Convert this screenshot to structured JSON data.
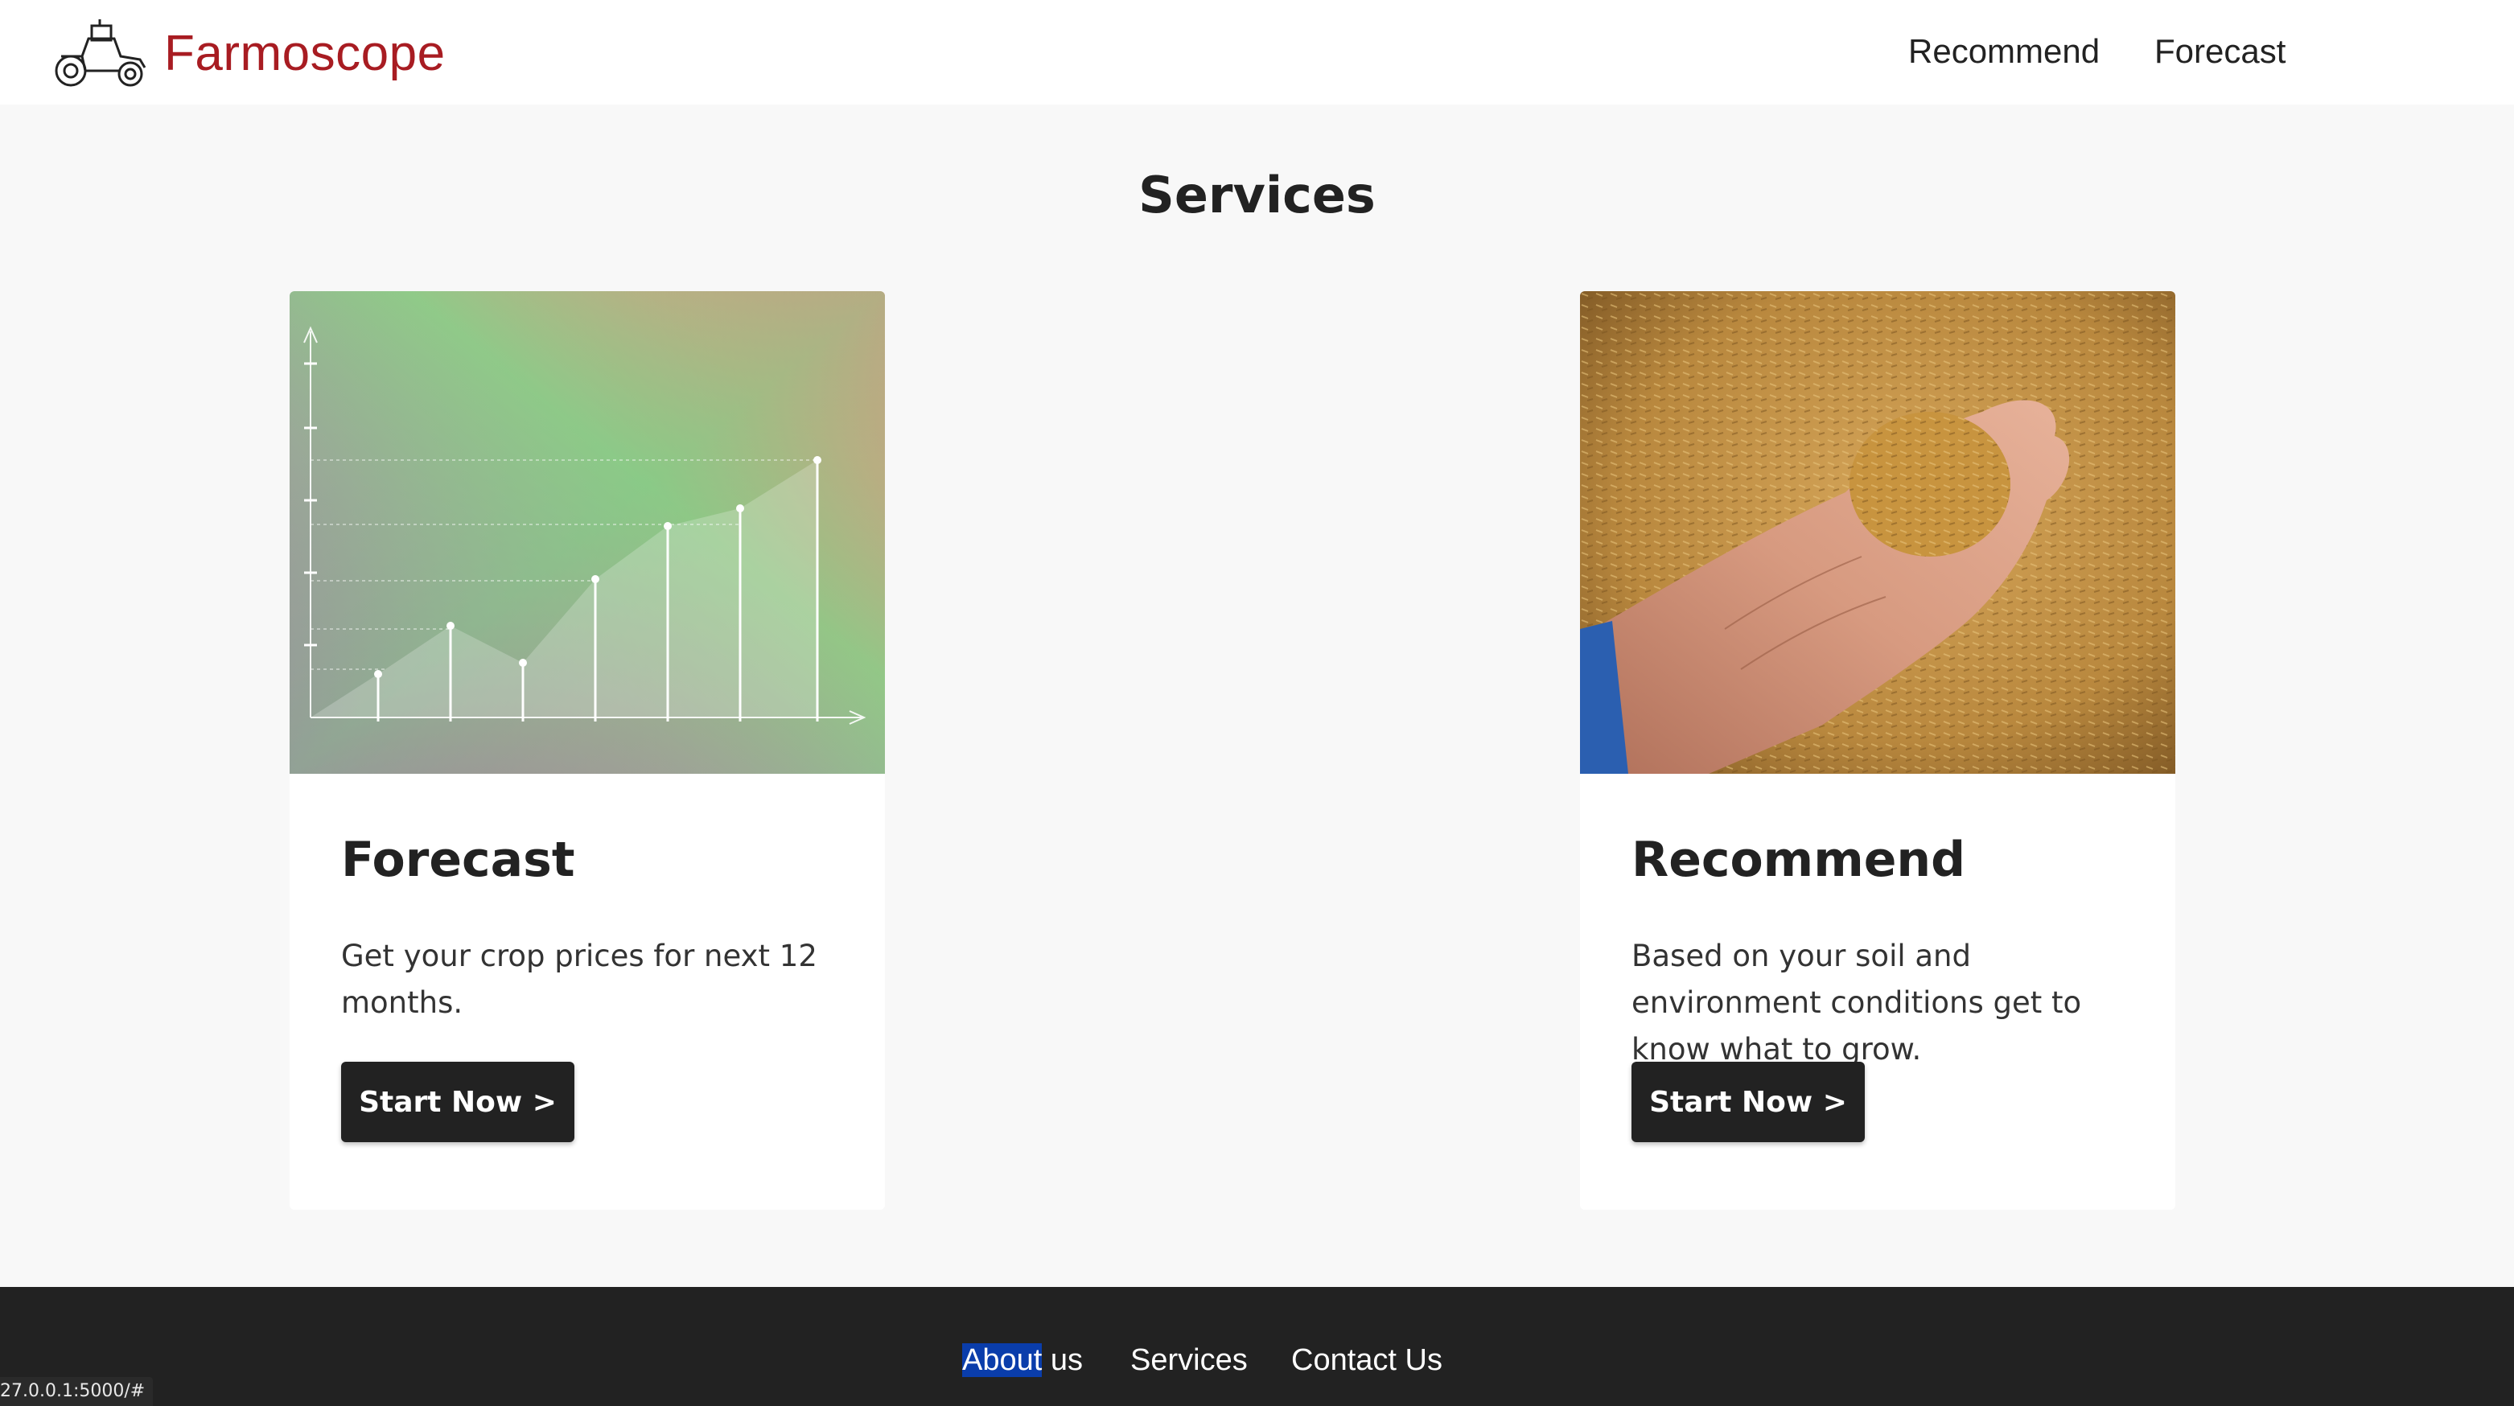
{
  "header": {
    "brand": "Farmoscope",
    "nav": [
      "Recommend",
      "Forecast"
    ]
  },
  "section_title": "Services",
  "cards": [
    {
      "title": "Forecast",
      "text": "Get your crop prices for next 12 months.",
      "button": "Start Now >",
      "image_icon": "price-growth-chart-icon"
    },
    {
      "title": "Recommend",
      "text": "Based on your soil and environment conditions get to know what to grow.",
      "button": "Start Now >",
      "image_icon": "hand-holding-grain-photo"
    }
  ],
  "footer": {
    "about_highlight": "About",
    "about_rest": " us",
    "services": "Services",
    "contact": "Contact Us"
  },
  "status_url": "27.0.0.1:5000/#",
  "colors": {
    "brand": "#a81c22",
    "dark": "#222222",
    "page_bg": "#f8f8f8",
    "highlight": "#0a3dab"
  }
}
